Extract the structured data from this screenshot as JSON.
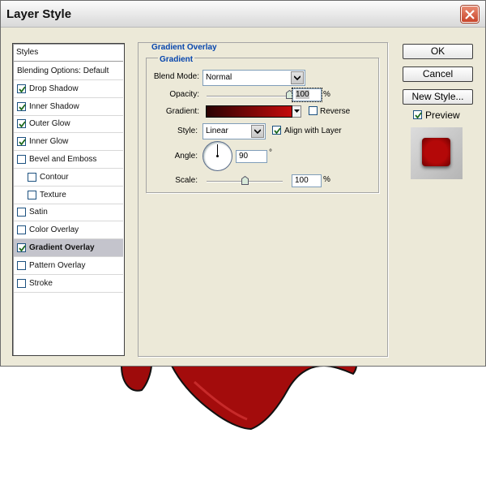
{
  "window": {
    "title": "Layer Style"
  },
  "styles_list": {
    "header": "Styles",
    "items": [
      {
        "label": "Blending Options: Default",
        "checkbox": false,
        "checked": false,
        "selected": false
      },
      {
        "label": "Drop Shadow",
        "checkbox": true,
        "checked": true,
        "selected": false
      },
      {
        "label": "Inner Shadow",
        "checkbox": true,
        "checked": true,
        "selected": false
      },
      {
        "label": "Outer Glow",
        "checkbox": true,
        "checked": true,
        "selected": false
      },
      {
        "label": "Inner Glow",
        "checkbox": true,
        "checked": true,
        "selected": false
      },
      {
        "label": "Bevel and Emboss",
        "checkbox": true,
        "checked": false,
        "selected": false
      },
      {
        "label": "Contour",
        "checkbox": true,
        "checked": false,
        "selected": false
      },
      {
        "label": "Texture",
        "checkbox": true,
        "checked": false,
        "selected": false
      },
      {
        "label": "Satin",
        "checkbox": true,
        "checked": false,
        "selected": false
      },
      {
        "label": "Color Overlay",
        "checkbox": true,
        "checked": false,
        "selected": false
      },
      {
        "label": "Gradient Overlay",
        "checkbox": true,
        "checked": true,
        "selected": true
      },
      {
        "label": "Pattern Overlay",
        "checkbox": true,
        "checked": false,
        "selected": false
      },
      {
        "label": "Stroke",
        "checkbox": true,
        "checked": false,
        "selected": false
      }
    ]
  },
  "panel": {
    "section_title": "Gradient Overlay",
    "group_title": "Gradient",
    "blend_mode": {
      "label": "Blend Mode:",
      "value": "Normal"
    },
    "opacity": {
      "label": "Opacity:",
      "value": "100",
      "unit": "%",
      "level": 1.0
    },
    "gradient": {
      "label": "Gradient:",
      "color_start": "#2a0202",
      "color_end": "#c40b0b",
      "reverse_label": "Reverse",
      "reverse_checked": false
    },
    "style": {
      "label": "Style:",
      "value": "Linear",
      "align_label": "Align with Layer",
      "align_checked": true
    },
    "angle": {
      "label": "Angle:",
      "value": "90",
      "unit": "°",
      "degrees": 90
    },
    "scale": {
      "label": "Scale:",
      "value": "100",
      "unit": "%",
      "level": 0.5
    }
  },
  "buttons": {
    "ok": "OK",
    "cancel": "Cancel",
    "new_style": "New Style...",
    "preview_label": "Preview",
    "preview_checked": true
  },
  "colors": {
    "accent_blue": "#0645ad",
    "preview_red": "#b40808",
    "checkmark": "#1f6b1f"
  }
}
